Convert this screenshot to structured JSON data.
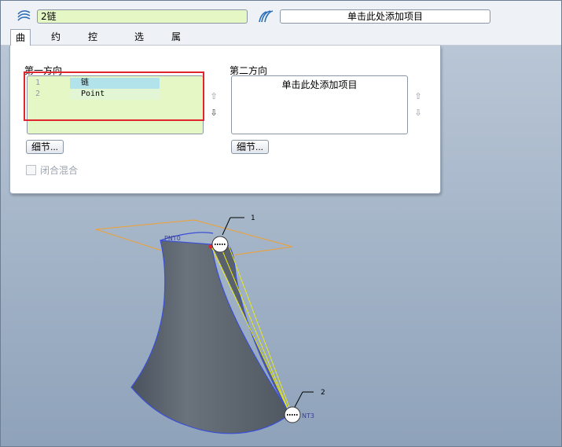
{
  "toolbar": {
    "curve_field_value": "2链",
    "second_field_value": "单击此处添加项目",
    "icon1": "boundary-blend-curve-icon",
    "icon2": "second-direction-curve-icon"
  },
  "tabs": [
    {
      "label": "曲线",
      "active": true
    },
    {
      "label": "约束"
    },
    {
      "label": "控制点"
    },
    {
      "label": "选项"
    },
    {
      "label": "属性"
    }
  ],
  "panel": {
    "first_direction": {
      "label": "第一方向",
      "rows": [
        {
          "num": "1",
          "value": "链"
        },
        {
          "num": "2",
          "value": "Point"
        }
      ],
      "detail_button": "细节..."
    },
    "second_direction": {
      "label": "第二方向",
      "placeholder": "单击此处添加项目",
      "detail_button": "细节..."
    },
    "closed_blend_label": "闭合混合",
    "closed_blend_checked": false
  },
  "viewport": {
    "point_label_top": "PNT0",
    "point_label_bottom": "NT3",
    "callout_1": "1",
    "callout_2": "2"
  },
  "colors": {
    "surface": "#5d6570",
    "surface_edge": "#3b4fd6",
    "datum_plane": "#f0a030",
    "selection_lines": "#e8e81c",
    "highlight_box": "#e0252c",
    "field_green": "#e6f7c6"
  }
}
